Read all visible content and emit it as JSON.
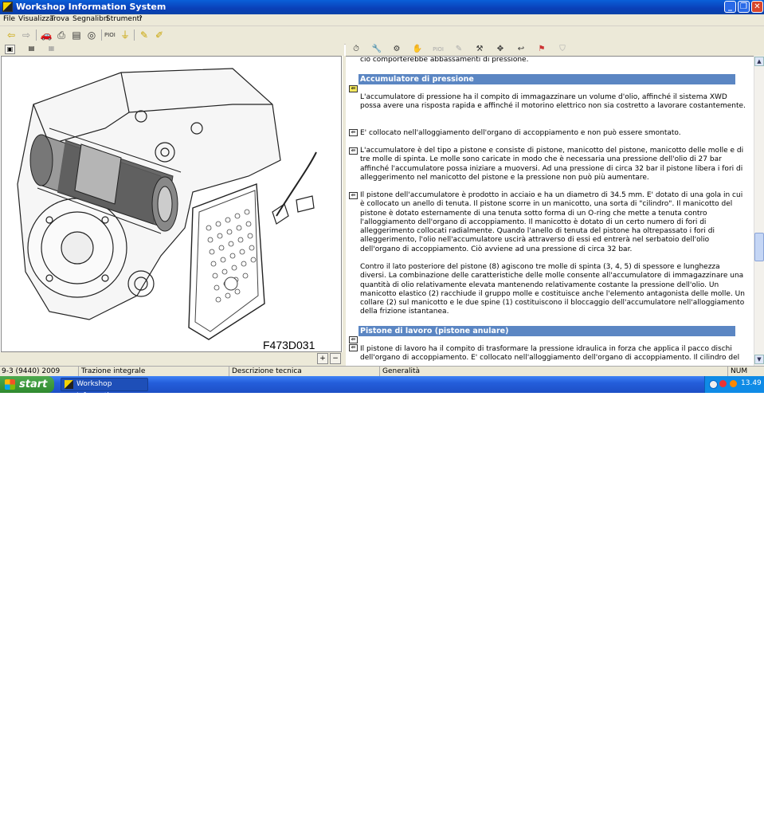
{
  "window": {
    "title": "Workshop Information System",
    "controls": [
      "_",
      "❐",
      "✕"
    ]
  },
  "menu": [
    "File",
    "Visualizza",
    "Trova",
    "Segnalibri",
    "Strumenti",
    "?"
  ],
  "toolbar": {
    "icons": [
      "back-arrow-icon",
      "forward-arrow-icon",
      "car-icon",
      "print-icon",
      "document-icon",
      "binoculars-icon",
      "pi-label",
      "funnel-icon",
      "pencil-icon",
      "note-icon"
    ],
    "pi_label": "PIOI"
  },
  "right_toolbar": {
    "pi_label": "PIOI"
  },
  "figure": {
    "label": "F473D031",
    "zoom_in": "+",
    "zoom_out": "−"
  },
  "document": {
    "top_fragment": "ciò comporterebbe abbassamenti di pressione.",
    "section1_heading": "Accumulatore di pressione",
    "para1": "L'accumulatore di pressione ha il compito di immagazzinare un volume d'olio, affinché il sistema XWD possa avere una risposta rapida e affinché il motorino elettrico non sia costretto a lavorare costantemente.",
    "para2": "E' collocato nell'alloggiamento dell'organo di accoppiamento e non può essere smontato.",
    "para3": "L'accumulatore è del tipo a pistone e consiste di pistone, manicotto del pistone, manicotto delle molle e di tre molle di spinta. Le molle sono caricate in modo che è necessaria una pressione dell'olio di 27 bar affinché l'accumulatore possa iniziare a muoversi. Ad una pressione di circa 32 bar il pistone libera i fori di alleggerimento nel manicotto del pistone e la pressione non può più aumentare.",
    "para4": "Il pistone dell'accumulatore è prodotto in acciaio e ha un diametro di 34.5 mm. E' dotato di una gola in cui è collocato un anello di tenuta. Il pistone scorre in un manicotto, una sorta di \"cilindro\". Il manicotto del pistone è dotato esternamente di una tenuta sotto forma di un O-ring che mette a tenuta contro l'alloggiamento dell'organo di accoppiamento. Il manicotto è dotato di un certo numero di fori di alleggerimento collocati radialmente. Quando l'anello di tenuta del pistone ha oltrepassato i fori di alleggerimento, l'olio nell'accumulatore uscirà attraverso di essi ed entrerà nel serbatoio dell'olio dell'organo di accoppiamento. Ciò avviene ad una pressione di circa 32 bar.",
    "para5": "Contro il lato posteriore del pistone (8) agiscono tre molle di spinta (3, 4, 5) di spessore e lunghezza diversi. La combinazione delle caratteristiche delle molle consente all'accumulatore di immagazzinare una quantità di olio relativamente elevata mantenendo relativamente costante la pressione dell'olio. Un manicotto elastico (2) racchiude il gruppo molle e costituisce anche l'elemento antagonista delle molle. Un collare (2) sul manicotto e le due spine (1) costituiscono il bloccaggio dell'accumulatore nell'alloggiamento della frizione istantanea.",
    "section2_heading": "Pistone di lavoro (pistone anulare)",
    "para6": "Il pistone di lavoro ha il compito di trasformare la pressione idraulica in forza che applica il pacco dischi dell'organo di accoppiamento. E' collocato nell'alloggiamento dell'organo di accoppiamento. Il cilindro del"
  },
  "statusbar": {
    "model": "9-3 (9440) 2009",
    "system": "Trazione integrale",
    "doc_type": "Descrizione tecnica",
    "section": "Generalità",
    "num": "NUM"
  },
  "taskbar": {
    "start": "start",
    "task": "Workshop Informatio...",
    "clock": "13.49"
  },
  "colors": {
    "heading_bg": "#5b86c3",
    "titlebar": "#0a4fc8",
    "taskbar": "#245edb",
    "start_green": "#3a9a3a"
  }
}
